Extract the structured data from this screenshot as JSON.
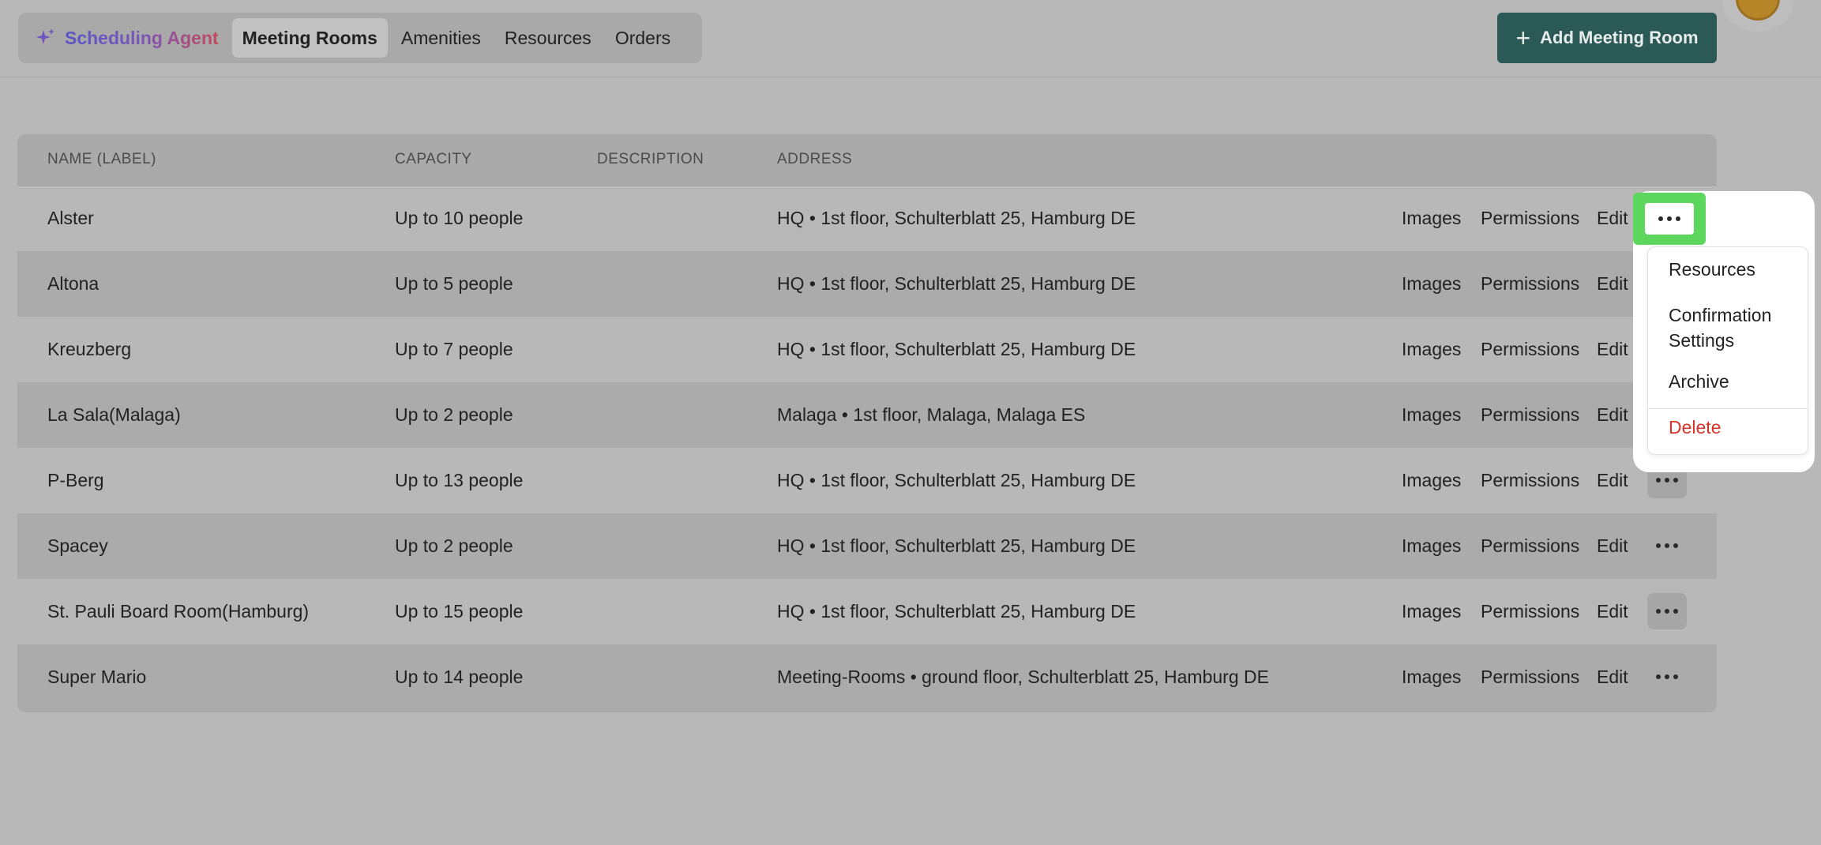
{
  "tabs": [
    {
      "label": "Scheduling Agent",
      "icon": "sparkle-icon"
    },
    {
      "label": "Meeting Rooms",
      "active": true
    },
    {
      "label": "Amenities"
    },
    {
      "label": "Resources"
    },
    {
      "label": "Orders"
    }
  ],
  "add_button": {
    "label": "Add Meeting Room",
    "icon": "plus-icon"
  },
  "table": {
    "headers": [
      "NAME (LABEL)",
      "CAPACITY",
      "DESCRIPTION",
      "ADDRESS"
    ],
    "actions": [
      "Images",
      "Permissions",
      "Edit"
    ],
    "rows": [
      {
        "name": "Alster",
        "capacity": "Up to 10 people",
        "description": "",
        "address": "HQ • 1st floor, Schulterblatt 25, Hamburg DE"
      },
      {
        "name": "Altona",
        "capacity": "Up to 5 people",
        "description": "",
        "address": "HQ • 1st floor, Schulterblatt 25, Hamburg DE"
      },
      {
        "name": "Kreuzberg",
        "capacity": "Up to 7 people",
        "description": "",
        "address": "HQ • 1st floor, Schulterblatt 25, Hamburg DE"
      },
      {
        "name": "La Sala(Malaga)",
        "capacity": "Up to 2 people",
        "description": "",
        "address": "Malaga • 1st floor, Malaga, Malaga ES"
      },
      {
        "name": "P-Berg",
        "capacity": "Up to 13 people",
        "description": "",
        "address": "HQ • 1st floor, Schulterblatt 25, Hamburg DE"
      },
      {
        "name": "Spacey",
        "capacity": "Up to 2 people",
        "description": "",
        "address": "HQ • 1st floor, Schulterblatt 25, Hamburg DE"
      },
      {
        "name": "St. Pauli Board Room(Hamburg)",
        "capacity": "Up to 15 people",
        "description": "",
        "address": "HQ • 1st floor, Schulterblatt 25, Hamburg DE"
      },
      {
        "name": "Super Mario",
        "capacity": "Up to 14 people",
        "description": "",
        "address": "Meeting-Rooms • ground floor, Schulterblatt 25, Hamburg DE"
      }
    ]
  },
  "dropdown": {
    "items": [
      "Resources",
      "Confirmation Settings",
      "Archive"
    ],
    "delete_label": "Delete"
  },
  "colors": {
    "accent": "#2b5956",
    "highlight": "#5cd65c",
    "danger": "#d8332a"
  }
}
